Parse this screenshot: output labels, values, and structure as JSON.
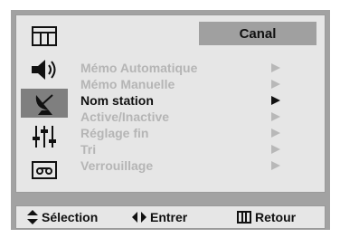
{
  "header": {
    "title": "Canal"
  },
  "sidebar": {
    "icons": [
      {
        "name": "picture-icon"
      },
      {
        "name": "sound-icon"
      },
      {
        "name": "antenna-icon"
      },
      {
        "name": "equalizer-icon"
      },
      {
        "name": "tape-icon"
      }
    ],
    "active_index": 2
  },
  "menu": {
    "items": [
      {
        "label": "Mémo Automatique"
      },
      {
        "label": "Mémo Manuelle"
      },
      {
        "label": "Nom station"
      },
      {
        "label": "Active/Inactive"
      },
      {
        "label": "Réglage fin"
      },
      {
        "label": "Tri"
      },
      {
        "label": "Verrouillage"
      }
    ],
    "selected_index": 2
  },
  "footer": {
    "select_label": "Sélection",
    "enter_label": "Entrer",
    "return_label": "Retour"
  },
  "colors": {
    "frame": "#a2a2a2",
    "panel": "#e6e6e6",
    "header": "#a0a0a0",
    "inactive_text": "#b5b5b5",
    "active_text": "#111111",
    "active_icon_bg": "#7f7f7f"
  }
}
